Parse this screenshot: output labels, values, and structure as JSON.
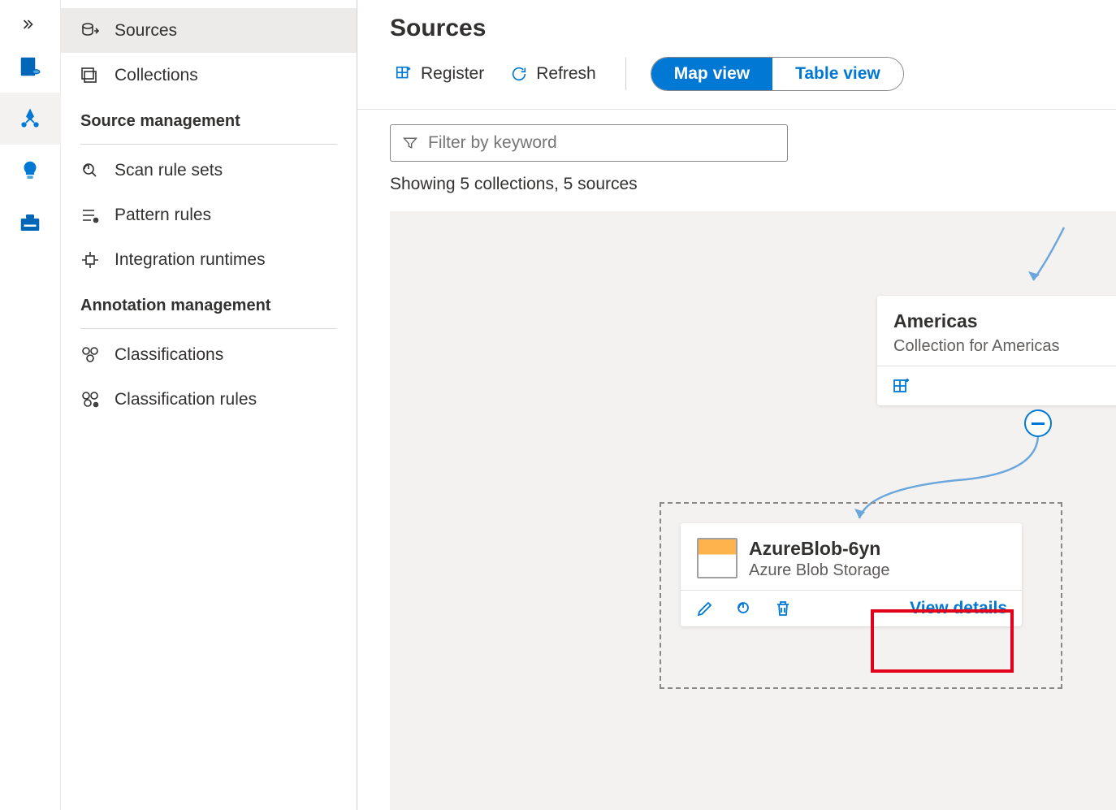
{
  "rail": {
    "items": [
      "data-catalog",
      "data-map",
      "insights",
      "management"
    ]
  },
  "sidebar": {
    "items": [
      {
        "label": "Sources"
      },
      {
        "label": "Collections"
      }
    ],
    "sections": [
      {
        "title": "Source management",
        "items": [
          {
            "label": "Scan rule sets"
          },
          {
            "label": "Pattern rules"
          },
          {
            "label": "Integration runtimes"
          }
        ]
      },
      {
        "title": "Annotation management",
        "items": [
          {
            "label": "Classifications"
          },
          {
            "label": "Classification rules"
          }
        ]
      }
    ]
  },
  "page": {
    "title": "Sources"
  },
  "toolbar": {
    "register": "Register",
    "refresh": "Refresh",
    "map": "Map view",
    "table": "Table view"
  },
  "filter": {
    "placeholder": "Filter by keyword"
  },
  "showing": "Showing 5 collections, 5 sources",
  "collection": {
    "name": "Americas",
    "desc": "Collection for Americas"
  },
  "source": {
    "name": "AzureBlob-6yn",
    "type": "Azure Blob Storage",
    "view_details": "View details"
  }
}
